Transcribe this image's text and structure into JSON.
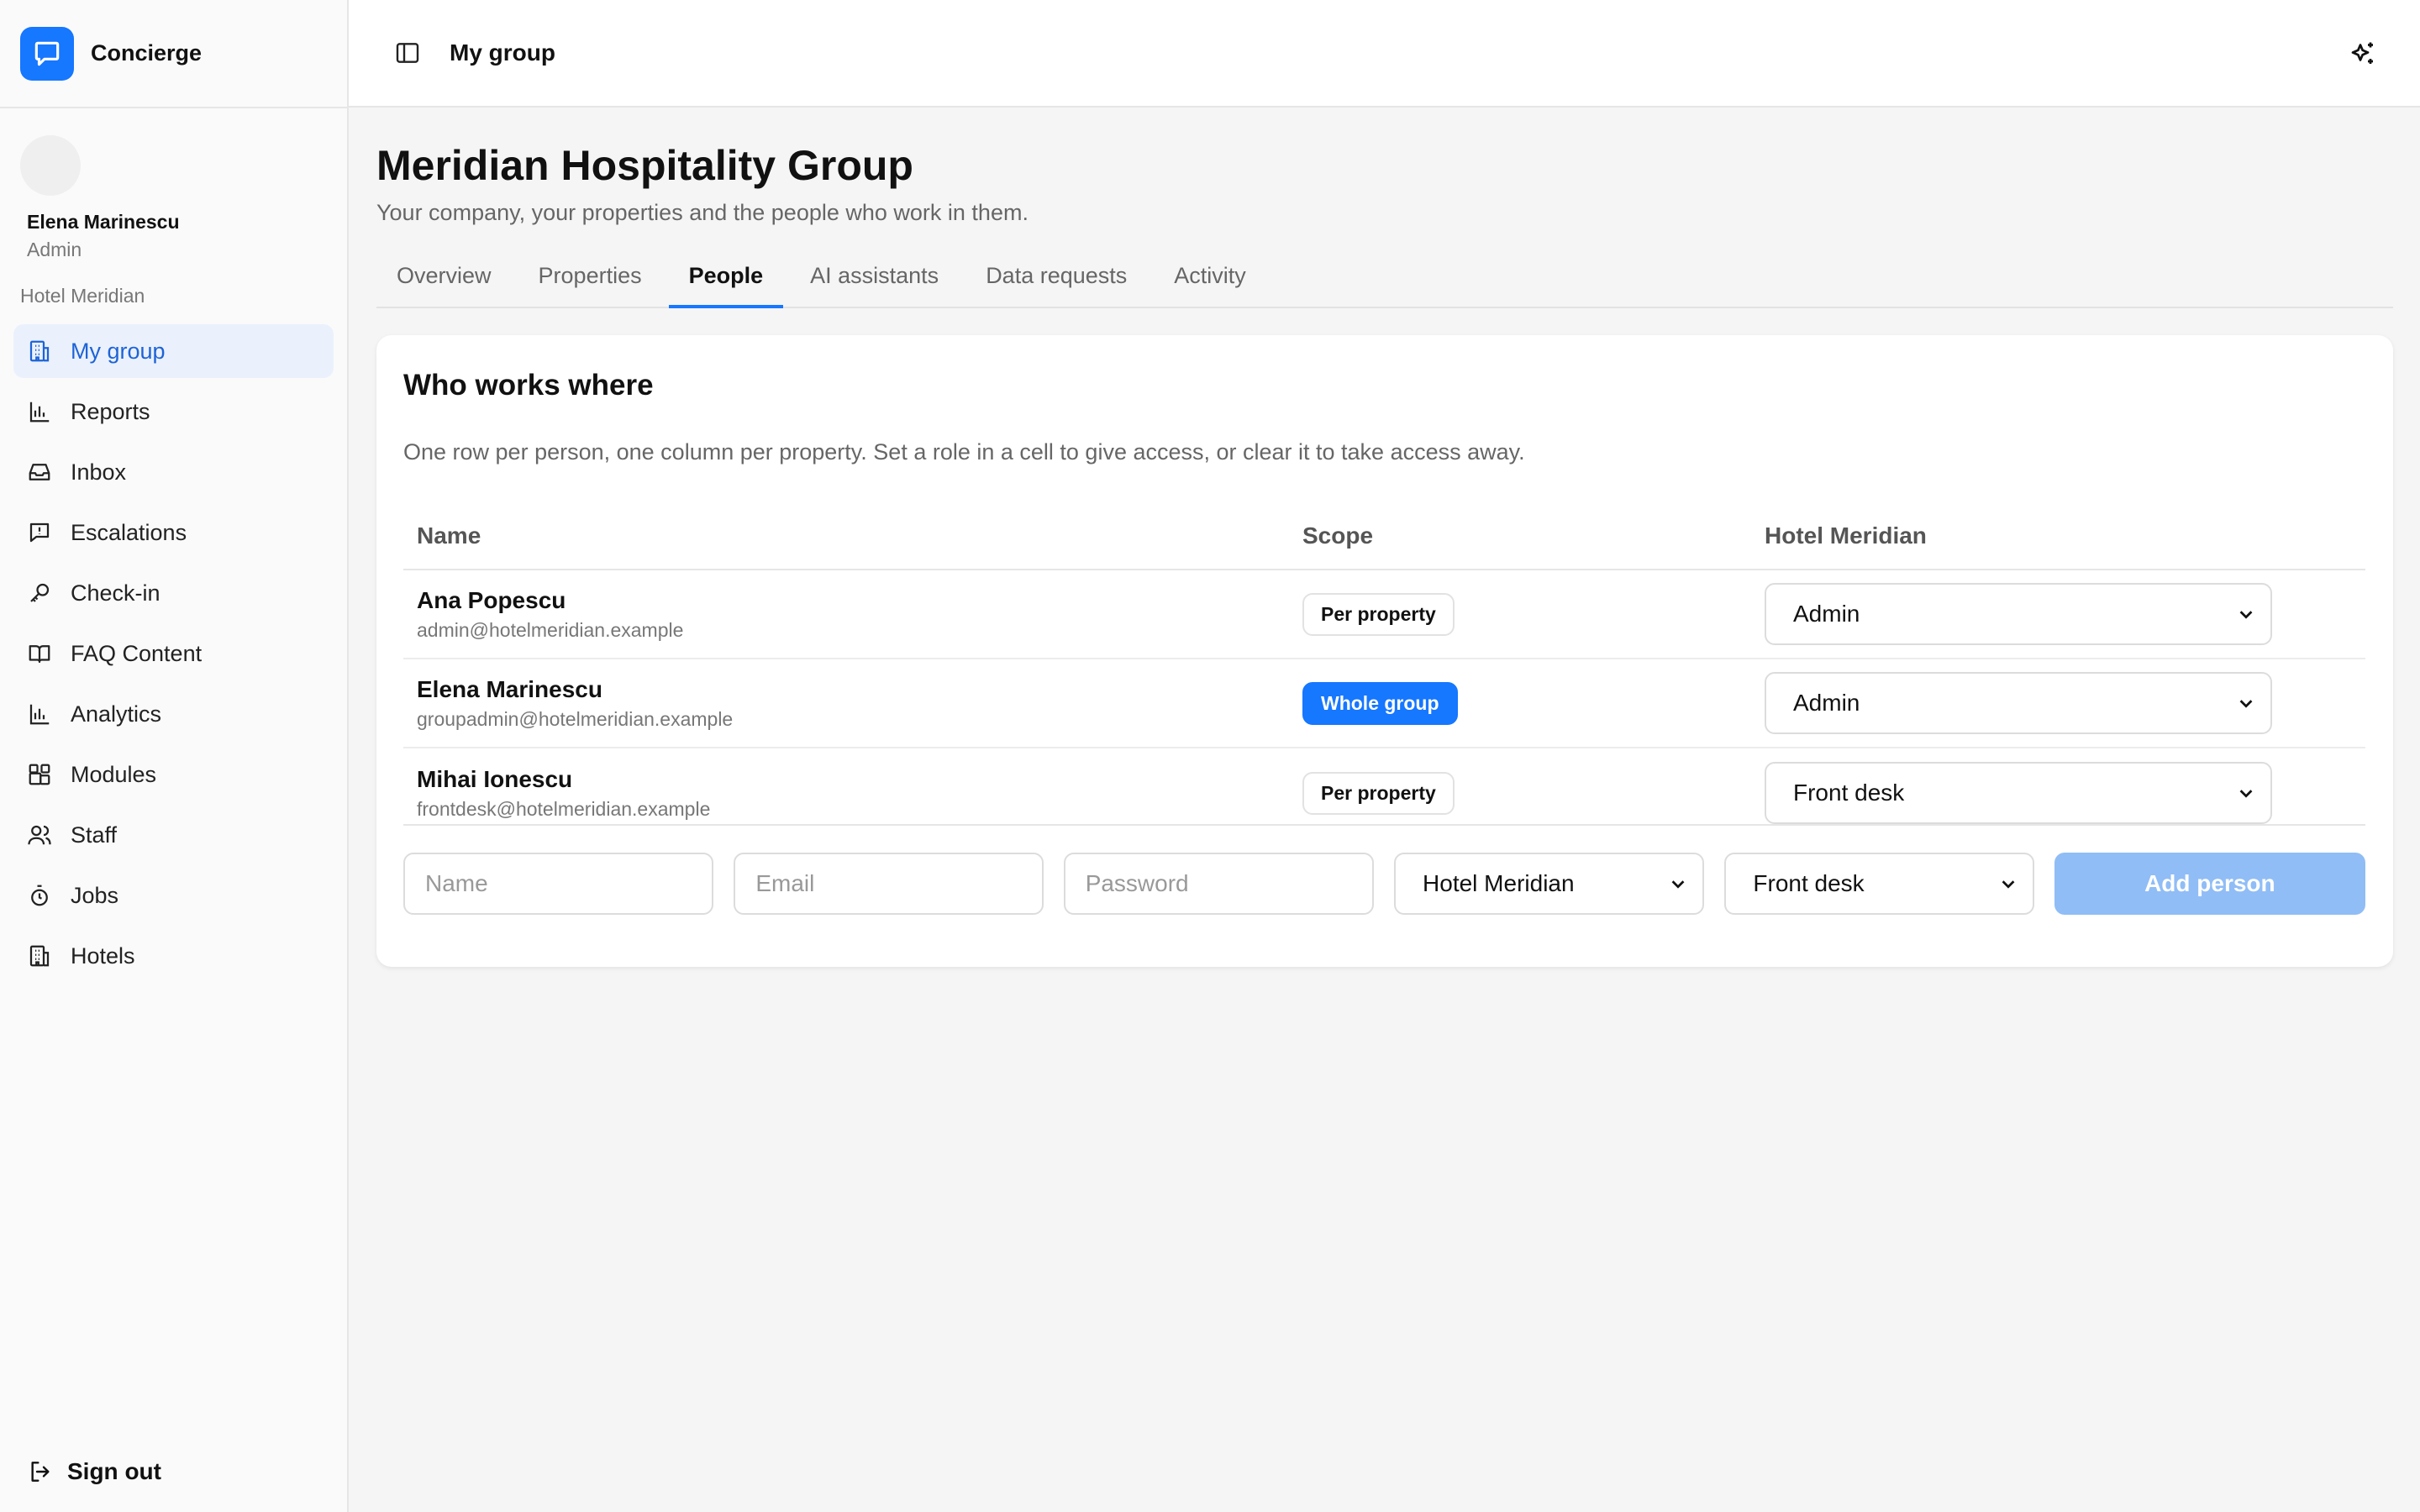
{
  "brand": {
    "name": "Concierge",
    "logo_icon": "chat-bubble-icon",
    "accent": "#1677ff"
  },
  "user": {
    "name": "Elena Marinescu",
    "role": "Admin",
    "hotel": "Hotel Meridian"
  },
  "sidebar": {
    "items": [
      {
        "label": "My group",
        "icon": "building-icon",
        "active": true
      },
      {
        "label": "Reports",
        "icon": "bar-chart-icon"
      },
      {
        "label": "Inbox",
        "icon": "inbox-icon"
      },
      {
        "label": "Escalations",
        "icon": "alert-message-icon"
      },
      {
        "label": "Check-in",
        "icon": "key-icon"
      },
      {
        "label": "FAQ Content",
        "icon": "book-icon"
      },
      {
        "label": "Analytics",
        "icon": "bar-chart-icon"
      },
      {
        "label": "Modules",
        "icon": "grid-plus-icon"
      },
      {
        "label": "Staff",
        "icon": "users-icon"
      },
      {
        "label": "Jobs",
        "icon": "timer-icon"
      },
      {
        "label": "Hotels",
        "icon": "building-icon"
      }
    ],
    "sign_out": "Sign out"
  },
  "header": {
    "title": "My group",
    "toggle_icon": "sidebar-toggle-icon",
    "ai_icon": "sparkles-icon"
  },
  "page": {
    "title": "Meridian Hospitality Group",
    "subtitle": "Your company, your properties and the people who work in them."
  },
  "tabs": [
    {
      "label": "Overview"
    },
    {
      "label": "Properties"
    },
    {
      "label": "People",
      "active": true
    },
    {
      "label": "AI assistants"
    },
    {
      "label": "Data requests"
    },
    {
      "label": "Activity"
    }
  ],
  "card": {
    "title": "Who works where",
    "description": "One row per person, one column per property. Set a role in a cell to give access, or clear it to take access away.",
    "columns": {
      "name": "Name",
      "scope": "Scope",
      "property": "Hotel Meridian"
    },
    "rows": [
      {
        "name": "Ana Popescu",
        "email": "admin@hotelmeridian.example",
        "scope": "Per property",
        "role": "Admin"
      },
      {
        "name": "Elena Marinescu",
        "email": "groupadmin@hotelmeridian.example",
        "scope": "Whole group",
        "role": "Admin"
      },
      {
        "name": "Mihai Ionescu",
        "email": "frontdesk@hotelmeridian.example",
        "scope": "Per property",
        "role": "Front desk"
      }
    ],
    "add": {
      "name_placeholder": "Name",
      "email_placeholder": "Email",
      "password_placeholder": "Password",
      "property_value": "Hotel Meridian",
      "role_value": "Front desk",
      "button": "Add person"
    }
  }
}
